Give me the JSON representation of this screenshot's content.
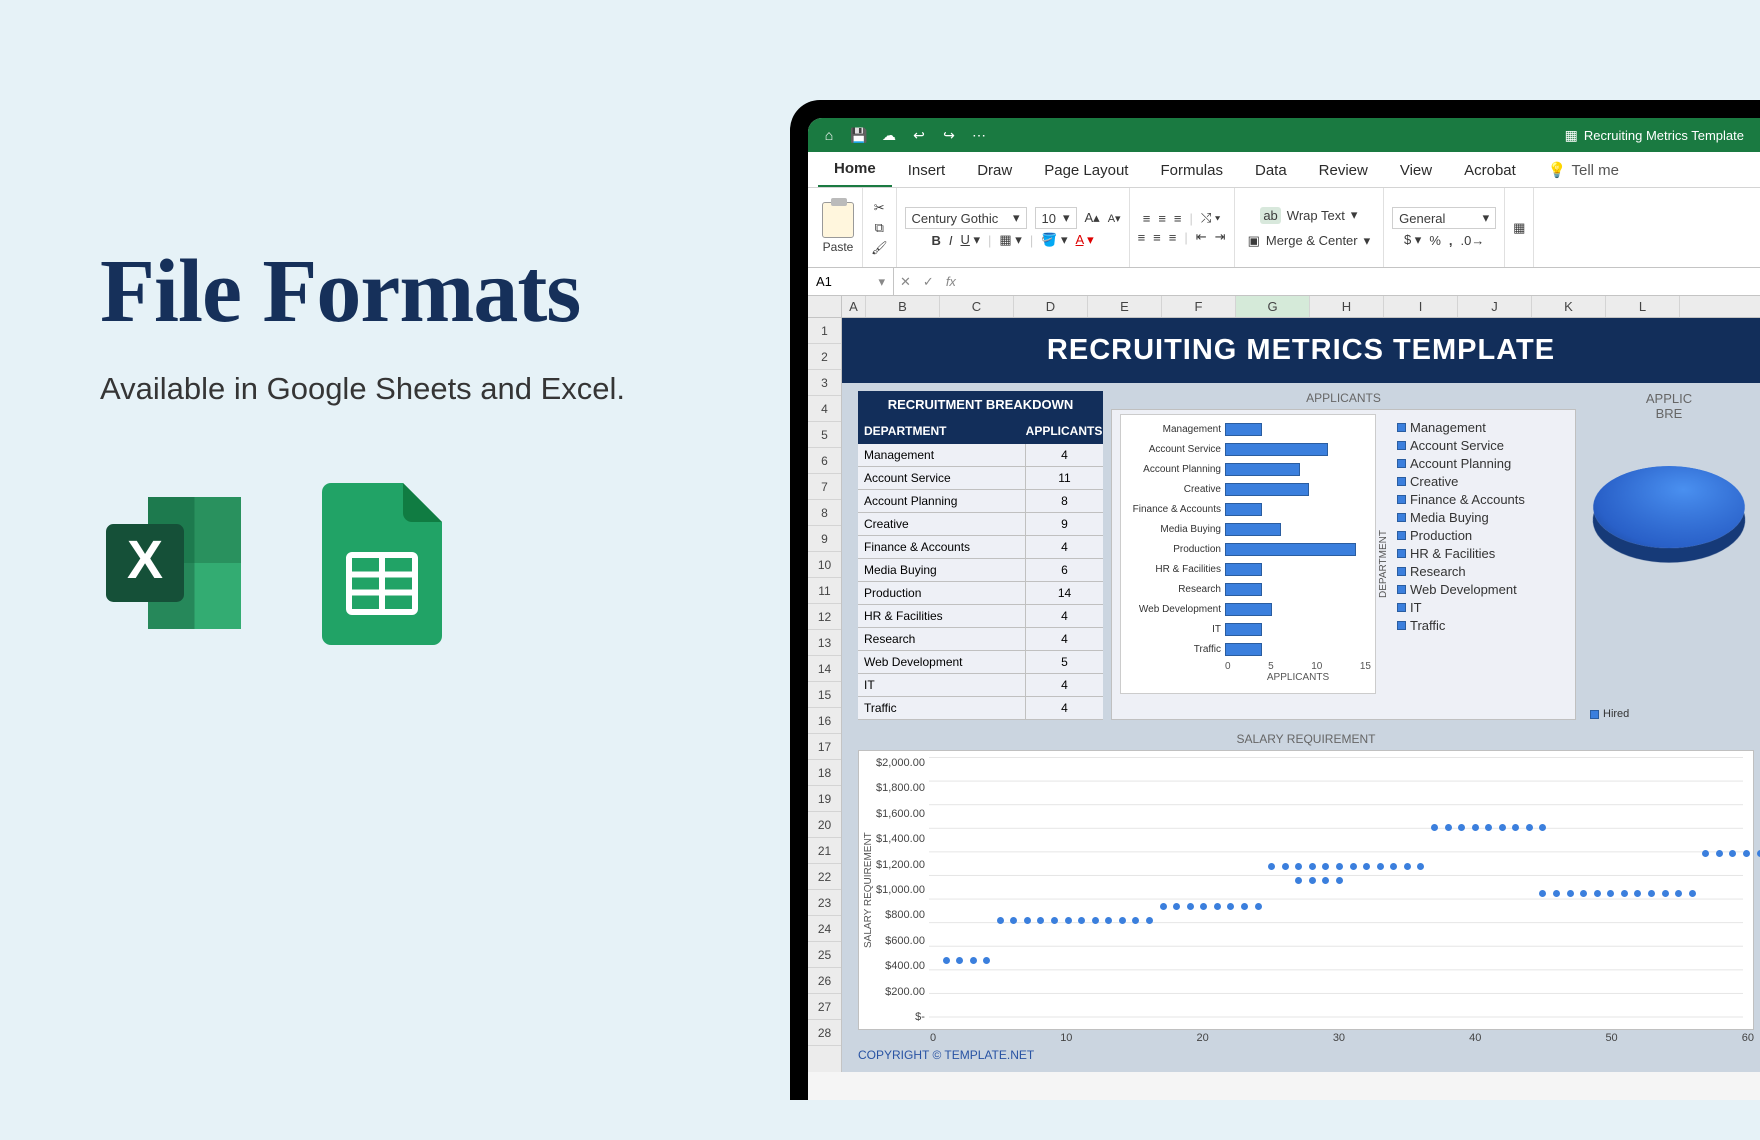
{
  "left": {
    "title": "File Formats",
    "subtitle": "Available in Google Sheets and Excel."
  },
  "titlebar": {
    "doc": "Recruiting Metrics Template"
  },
  "tabs": [
    "Home",
    "Insert",
    "Draw",
    "Page Layout",
    "Formulas",
    "Data",
    "Review",
    "View",
    "Acrobat"
  ],
  "tellme": "Tell me",
  "ribbon": {
    "paste": "Paste",
    "font": "Century Gothic",
    "fontsize": "10",
    "wrap": "Wrap Text",
    "merge": "Merge & Center",
    "numfmt": "General"
  },
  "namebox": "A1",
  "cols": [
    "A",
    "B",
    "C",
    "D",
    "E",
    "F",
    "G",
    "H",
    "I",
    "J",
    "K",
    "L"
  ],
  "rows_count": 28,
  "banner": "RECRUITING METRICS TEMPLATE",
  "table": {
    "title": "RECRUITMENT BREAKDOWN",
    "c1": "DEPARTMENT",
    "c2": "APPLICANTS",
    "rows": [
      {
        "name": "Management",
        "val": "4"
      },
      {
        "name": "Account Service",
        "val": "11"
      },
      {
        "name": "Account Planning",
        "val": "8"
      },
      {
        "name": "Creative",
        "val": "9"
      },
      {
        "name": "Finance & Accounts",
        "val": "4"
      },
      {
        "name": "Media Buying",
        "val": "6"
      },
      {
        "name": "Production",
        "val": "14"
      },
      {
        "name": "HR & Facilities",
        "val": "4"
      },
      {
        "name": "Research",
        "val": "4"
      },
      {
        "name": "Web Development",
        "val": "5"
      },
      {
        "name": "IT",
        "val": "4"
      },
      {
        "name": "Traffic",
        "val": "4"
      }
    ]
  },
  "bars": {
    "title": "APPLICANTS",
    "ylabel": "DEPARTMENT",
    "xlabel": "APPLICANTS",
    "ticks": [
      "0",
      "5",
      "10",
      "15"
    ]
  },
  "legend_extra": "Hired",
  "pie": {
    "t1": "APPLIC",
    "t2": "BRE"
  },
  "salary": {
    "title": "SALARY REQUIREMENT",
    "ylabel": "SALARY REQUIREMENT",
    "yticks": [
      "$2,000.00",
      "$1,800.00",
      "$1,600.00",
      "$1,400.00",
      "$1,200.00",
      "$1,000.00",
      "$800.00",
      "$600.00",
      "$400.00",
      "$200.00",
      "$-"
    ],
    "xticks": [
      "0",
      "10",
      "20",
      "30",
      "40",
      "50",
      "60"
    ]
  },
  "copyright": "COPYRIGHT © TEMPLATE.NET",
  "chart_data": [
    {
      "type": "bar",
      "title": "APPLICANTS",
      "xlabel": "APPLICANTS",
      "ylabel": "DEPARTMENT",
      "orientation": "horizontal",
      "categories": [
        "Management",
        "Account Service",
        "Account Planning",
        "Creative",
        "Finance & Accounts",
        "Media Buying",
        "Production",
        "HR & Facilities",
        "Research",
        "Web Development",
        "IT",
        "Traffic"
      ],
      "values": [
        4,
        11,
        8,
        9,
        4,
        6,
        14,
        4,
        4,
        5,
        4,
        4
      ],
      "xlim": [
        0,
        15
      ],
      "legend": [
        "Management",
        "Account Service",
        "Account Planning",
        "Creative",
        "Finance & Accounts",
        "Media Buying",
        "Production",
        "HR & Facilities",
        "Research",
        "Web Development",
        "IT",
        "Traffic"
      ]
    },
    {
      "type": "pie",
      "title": "APPLICANT BREAKDOWN",
      "legend": [
        "Hired"
      ],
      "note": "partially visible; full slice data not legible"
    },
    {
      "type": "scatter",
      "title": "SALARY REQUIREMENT",
      "xlabel": "",
      "ylabel": "SALARY REQUIREMENT",
      "xlim": [
        0,
        60
      ],
      "ylim": [
        0,
        2000
      ],
      "series": [
        {
          "name": "cluster",
          "y": 500,
          "x_start": 1,
          "x_end": 4
        },
        {
          "name": "cluster",
          "y": 800,
          "x_start": 5,
          "x_end": 16
        },
        {
          "name": "cluster",
          "y": 900,
          "x_start": 17,
          "x_end": 24
        },
        {
          "name": "cluster",
          "y": 1100,
          "x_start": 27,
          "x_end": 30
        },
        {
          "name": "cluster",
          "y": 1200,
          "x_start": 25,
          "x_end": 36
        },
        {
          "name": "cluster",
          "y": 1500,
          "x_start": 37,
          "x_end": 45
        },
        {
          "name": "cluster",
          "y": 1000,
          "x_start": 45,
          "x_end": 56
        },
        {
          "name": "cluster",
          "y": 1300,
          "x_start": 57,
          "x_end": 62
        }
      ]
    }
  ]
}
